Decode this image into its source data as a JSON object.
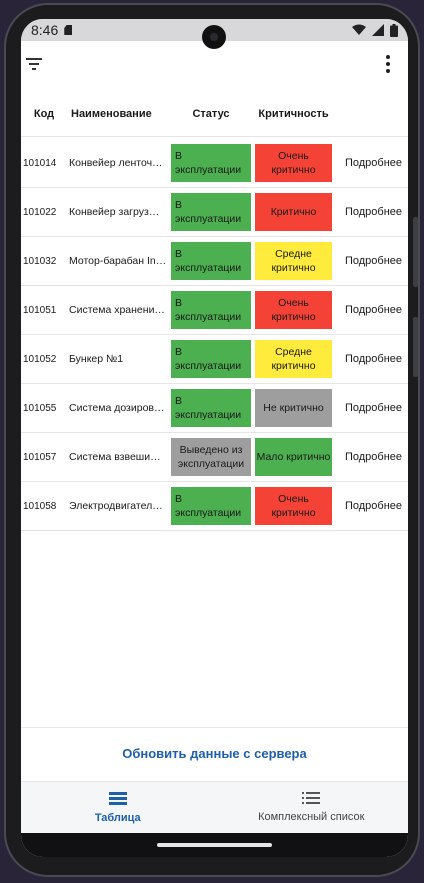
{
  "status_bar": {
    "time": "8:46"
  },
  "table": {
    "headers": {
      "code": "Код",
      "name": "Наименование",
      "status": "Статус",
      "criticality": "Критичность"
    },
    "rows": [
      {
        "code": "101014",
        "name": "Конвейер ленточ…",
        "status": "В эксплуатации",
        "status_color": "#4caf50",
        "criticality": "Очень критично",
        "criticality_color": "#f44336",
        "more": "Подробнее"
      },
      {
        "code": "101022",
        "name": "Конвейер загруз…",
        "status": "В эксплуатации",
        "status_color": "#4caf50",
        "criticality": "Критично",
        "criticality_color": "#f44336",
        "more": "Подробнее"
      },
      {
        "code": "101032",
        "name": "Мотор-барабан In…",
        "status": "В эксплуатации",
        "status_color": "#4caf50",
        "criticality": "Средне критично",
        "criticality_color": "#ffeb3b",
        "more": "Подробнее"
      },
      {
        "code": "101051",
        "name": "Система хранени…",
        "status": "В эксплуатации",
        "status_color": "#4caf50",
        "criticality": "Очень критично",
        "criticality_color": "#f44336",
        "more": "Подробнее"
      },
      {
        "code": "101052",
        "name": "Бункер  №1",
        "status": "В эксплуатации",
        "status_color": "#4caf50",
        "criticality": "Средне критично",
        "criticality_color": "#ffeb3b",
        "more": "Подробнее"
      },
      {
        "code": "101055",
        "name": "Система дозиров…",
        "status": "В эксплуатации",
        "status_color": "#4caf50",
        "criticality": "Не критично",
        "criticality_color": "#9e9e9e",
        "more": "Подробнее"
      },
      {
        "code": "101057",
        "name": "Система взвеши…",
        "status": "Выведено из эксплуатации",
        "status_color": "#9e9e9e",
        "criticality": "Мало критично",
        "criticality_color": "#4caf50",
        "more": "Подробнее"
      },
      {
        "code": "101058",
        "name": "Электродвигател…",
        "status": "В эксплуатации",
        "status_color": "#4caf50",
        "criticality": "Очень критично",
        "criticality_color": "#f44336",
        "more": "Подробнее"
      }
    ]
  },
  "refresh_button": "Обновить данные с сервера",
  "bottom_nav": {
    "table": "Таблица",
    "complex_list": "Комплексный список"
  },
  "icons": {
    "filter": "filter-icon",
    "more": "more-vert-icon",
    "table": "table-rows-icon",
    "list": "list-icon"
  }
}
